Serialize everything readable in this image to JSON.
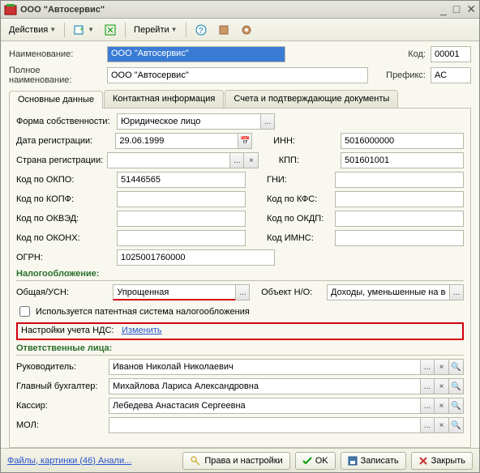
{
  "window": {
    "title": "ООО \"Автосервис\""
  },
  "toolbar": {
    "actions": "Действия",
    "goto": "Перейти"
  },
  "header": {
    "name_label": "Наименование:",
    "name_value": "ООО \"Автосервис\"",
    "code_label": "Код:",
    "code_value": "00001",
    "fullname_label": "Полное наименование:",
    "fullname_value": "ООО \"Автосервис\"",
    "prefix_label": "Префикс:",
    "prefix_value": "АС"
  },
  "tabs": {
    "main": "Основные данные",
    "contact": "Контактная информация",
    "accounts": "Счета и подтверждающие документы"
  },
  "main": {
    "owner_form_label": "Форма собственности:",
    "owner_form_value": "Юридическое лицо",
    "reg_date_label": "Дата регистрации:",
    "reg_date_value": "29.06.1999",
    "inn_label": "ИНН:",
    "inn_value": "5016000000",
    "reg_country_label": "Страна регистрации:",
    "reg_country_value": "",
    "kpp_label": "КПП:",
    "kpp_value": "501601001",
    "okpo_label": "Код по ОКПО:",
    "okpo_value": "51446565",
    "gni_label": "ГНИ:",
    "gni_value": "",
    "kopf_label": "Код по КОПФ:",
    "kopf_value": "",
    "kfs_label": "Код по КФС:",
    "kfs_value": "",
    "okved_label": "Код по ОКВЭД:",
    "okved_value": "",
    "okdp_label": "Код по ОКДП:",
    "okdp_value": "",
    "okonx_label": "Код по ОКОНХ:",
    "okonx_value": "",
    "imns_label": "Код ИМНС:",
    "imns_value": "",
    "ogrn_label": "ОГРН:",
    "ogrn_value": "1025001760000"
  },
  "tax": {
    "section": "Налогообложение:",
    "system_label": "Общая/УСН:",
    "system_value": "Упрощенная",
    "object_label": "Объект Н/О:",
    "object_value": "Доходы, уменьшенные на ве",
    "patent_label": "Используется патентная система налогообложения",
    "vat_label": "Настройки учета НДС:",
    "vat_change": "Изменить"
  },
  "persons": {
    "section": "Ответственные лица:",
    "head_label": "Руководитель:",
    "head_value": "Иванов Николай Николаевич",
    "acc_label": "Главный бухгалтер:",
    "acc_value": "Михайлова Лариса Александровна",
    "cashier_label": "Кассир:",
    "cashier_value": "Лебедева Анастасия Сергеевна",
    "mol_label": "МОЛ:",
    "mol_value": ""
  },
  "footer": {
    "files_link": "Файлы, картинки (46) Анали...",
    "rights": "Права и настройки",
    "ok": "OK",
    "save": "Записать",
    "close": "Закрыть"
  }
}
